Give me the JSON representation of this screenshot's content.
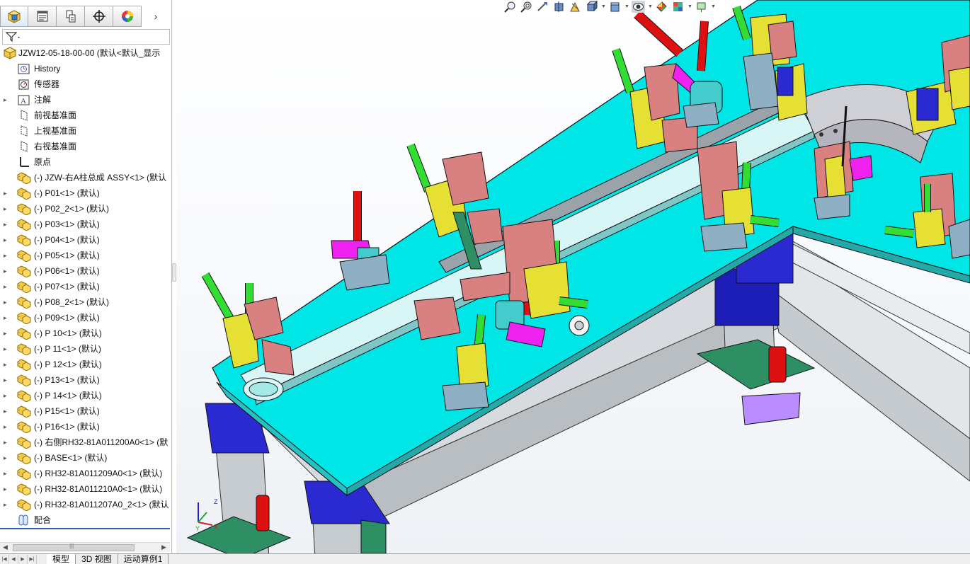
{
  "panel": {
    "tabs": [
      {
        "icon": "feature-manager-icon"
      },
      {
        "icon": "property-manager-icon"
      },
      {
        "icon": "configuration-manager-icon"
      },
      {
        "icon": "dimxpert-icon"
      },
      {
        "icon": "display-manager-icon"
      }
    ],
    "more_arrow": "›",
    "filter_icon": "filter-icon"
  },
  "tree": {
    "root": "JZW12-05-18-00-00  (默认<默认_显示",
    "items": [
      {
        "label": "History",
        "icon": "history-icon",
        "expandable": false
      },
      {
        "label": "传感器",
        "icon": "sensor-icon",
        "expandable": false
      },
      {
        "label": "注解",
        "icon": "annotation-icon",
        "expandable": true
      },
      {
        "label": "前视基准面",
        "icon": "plane-icon",
        "expandable": false
      },
      {
        "label": "上视基准面",
        "icon": "plane-icon",
        "expandable": false
      },
      {
        "label": "右视基准面",
        "icon": "plane-icon",
        "expandable": false
      },
      {
        "label": "原点",
        "icon": "origin-icon",
        "expandable": false
      },
      {
        "label": "(-) JZW-右A柱总成 ASSY<1> (默认",
        "icon": "subassembly-icon",
        "expandable": false
      },
      {
        "label": "(-) P01<1> (默认)",
        "icon": "subassembly-icon",
        "expandable": true
      },
      {
        "label": "(-) P02_2<1> (默认)",
        "icon": "subassembly-icon",
        "expandable": true
      },
      {
        "label": "(-) P03<1> (默认)",
        "icon": "subassembly-icon",
        "expandable": true
      },
      {
        "label": "(-) P04<1> (默认)",
        "icon": "subassembly-icon",
        "expandable": true
      },
      {
        "label": "(-) P05<1> (默认)",
        "icon": "subassembly-icon",
        "expandable": true
      },
      {
        "label": "(-) P06<1> (默认)",
        "icon": "subassembly-icon",
        "expandable": true
      },
      {
        "label": "(-) P07<1> (默认)",
        "icon": "subassembly-icon",
        "expandable": true
      },
      {
        "label": "(-) P08_2<1> (默认)",
        "icon": "subassembly-icon",
        "expandable": true
      },
      {
        "label": "(-) P09<1> (默认)",
        "icon": "subassembly-icon",
        "expandable": true
      },
      {
        "label": "(-) P 10<1> (默认)",
        "icon": "subassembly-icon",
        "expandable": true
      },
      {
        "label": "(-) P 11<1> (默认)",
        "icon": "subassembly-icon",
        "expandable": true
      },
      {
        "label": "(-) P 12<1> (默认)",
        "icon": "subassembly-icon",
        "expandable": true
      },
      {
        "label": "(-) P13<1> (默认)",
        "icon": "subassembly-icon",
        "expandable": true
      },
      {
        "label": "(-) P 14<1> (默认)",
        "icon": "subassembly-icon",
        "expandable": true
      },
      {
        "label": "(-) P15<1> (默认)",
        "icon": "subassembly-icon",
        "expandable": true
      },
      {
        "label": "(-) P16<1> (默认)",
        "icon": "subassembly-icon",
        "expandable": true
      },
      {
        "label": "(-) 右侧RH32-81A011200A0<1> (默",
        "icon": "subassembly-icon",
        "expandable": true
      },
      {
        "label": "(-) BASE<1> (默认)",
        "icon": "subassembly-icon",
        "expandable": true
      },
      {
        "label": "(-) RH32-81A011209A0<1> (默认)",
        "icon": "subassembly-icon",
        "expandable": true
      },
      {
        "label": "(-) RH32-81A011210A0<1> (默认)",
        "icon": "subassembly-icon",
        "expandable": true
      },
      {
        "label": "(-) RH32-81A011207A0_2<1> (默认",
        "icon": "subassembly-icon",
        "expandable": true
      },
      {
        "label": "配合",
        "icon": "mates-icon",
        "expandable": false
      }
    ]
  },
  "bottom_tabs": [
    "模型",
    "3D 视图",
    "运动算例1"
  ],
  "heads_up_toolbar": [
    "zoom-to-fit-icon",
    "zoom-to-area-icon",
    "previous-view-icon",
    "section-view-icon",
    "dynamic-annotation-icon",
    "view-orientation-icon",
    "display-style-icon",
    "hide-show-icon",
    "edit-appearance-icon",
    "apply-scene-icon",
    "view-settings-icon"
  ],
  "triad": {
    "x": "X",
    "y": "Y",
    "z": "Z"
  },
  "colors": {
    "table_top": "#00e5e5",
    "frame": "#c8cdd2",
    "clamp_yellow": "#e5e033",
    "block_pink": "#d98080",
    "handle_green": "#33dd33",
    "handle_red": "#dd1111",
    "accent_blue": "#2f2fd6"
  }
}
